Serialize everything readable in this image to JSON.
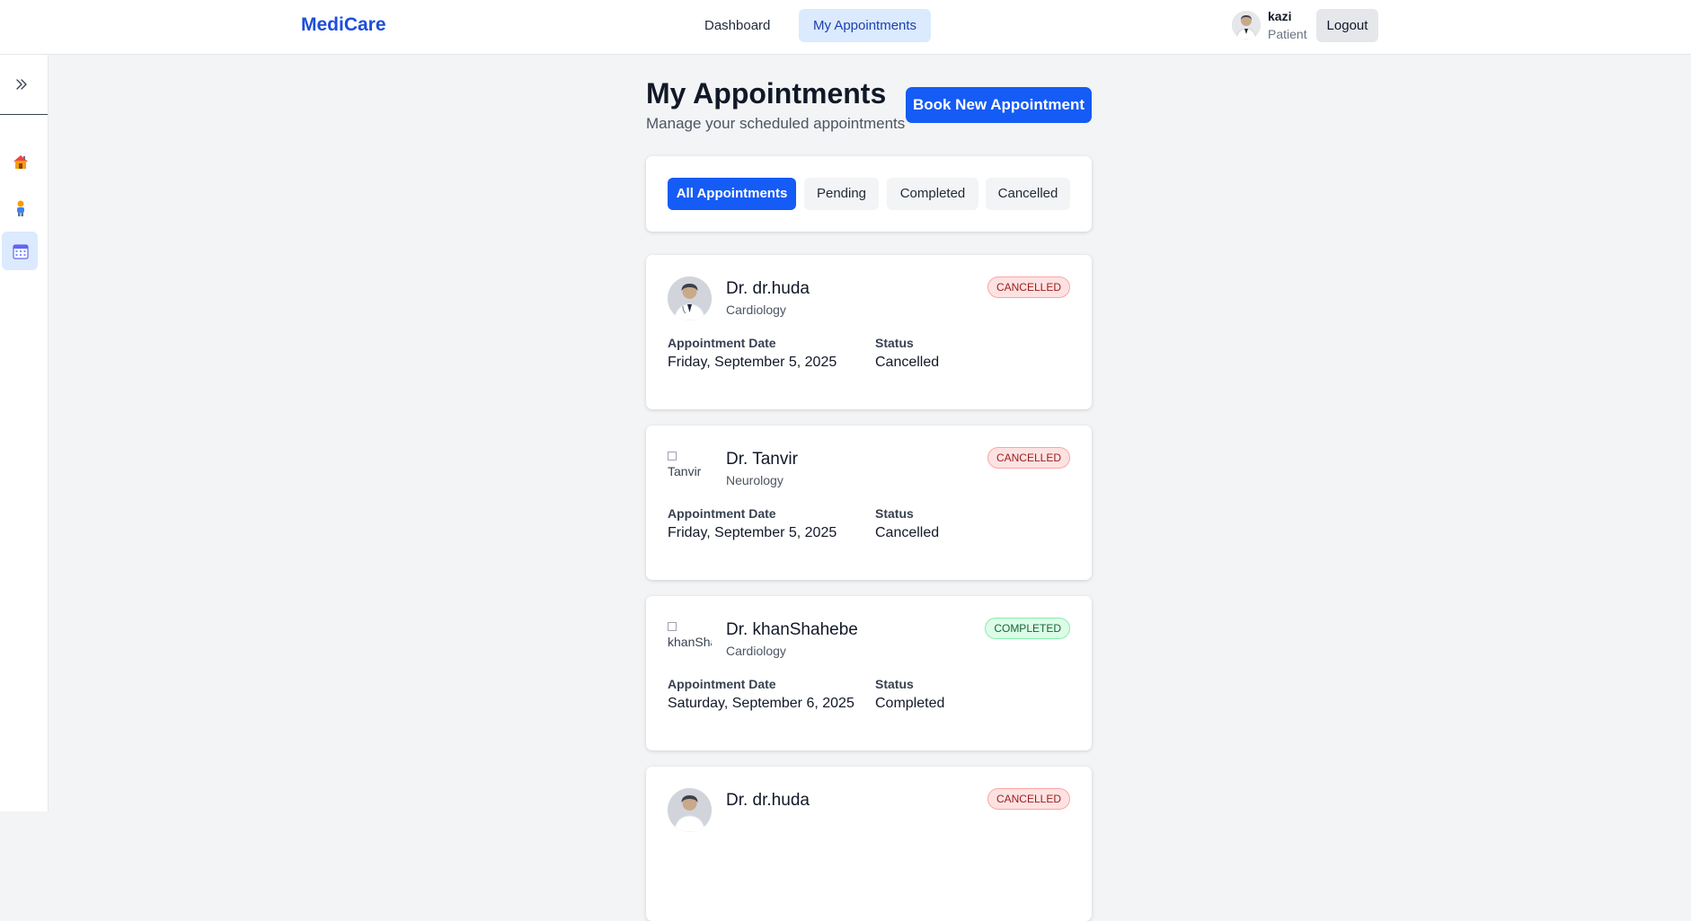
{
  "header": {
    "brand": "MediCare",
    "nav": [
      {
        "label": "Dashboard",
        "active": false
      },
      {
        "label": "My Appointments",
        "active": true
      }
    ],
    "user": {
      "name": "kazi",
      "role": "Patient"
    },
    "logout_label": "Logout"
  },
  "sidebar": {
    "items": [
      {
        "icon": "house-icon"
      },
      {
        "icon": "person-icon"
      },
      {
        "icon": "calendar-icon",
        "active": true
      }
    ]
  },
  "main": {
    "title": "My Appointments",
    "subtitle": "Manage your scheduled appointments",
    "book_label": "Book New Appointment",
    "filters": [
      {
        "label": "All Appointments",
        "active": true
      },
      {
        "label": "Pending",
        "active": false
      },
      {
        "label": "Completed",
        "active": false
      },
      {
        "label": "Cancelled",
        "active": false
      }
    ],
    "labels": {
      "date": "Appointment Date",
      "status": "Status"
    },
    "appointments": [
      {
        "doctor": "Dr. dr.huda",
        "specialty": "Cardiology",
        "badge": "CANCELLED",
        "date": "Friday, September 5, 2025",
        "status": "Cancelled",
        "avatar_alt": ""
      },
      {
        "doctor": "Dr. Tanvir",
        "specialty": "Neurology",
        "badge": "CANCELLED",
        "date": "Friday, September 5, 2025",
        "status": "Cancelled",
        "avatar_alt": "Tanvir"
      },
      {
        "doctor": "Dr. khanShahebe",
        "specialty": "Cardiology",
        "badge": "COMPLETED",
        "date": "Saturday, September 6, 2025",
        "status": "Completed",
        "avatar_alt": "khanShahebe"
      },
      {
        "doctor": "Dr. dr.huda",
        "specialty": "",
        "badge": "CANCELLED",
        "date": "",
        "status": "",
        "avatar_alt": ""
      }
    ]
  },
  "colors": {
    "brand": "#1d4ed8",
    "primary": "#155bf5",
    "cancelled_bg": "#fee2e2",
    "completed_bg": "#dcfce7"
  }
}
